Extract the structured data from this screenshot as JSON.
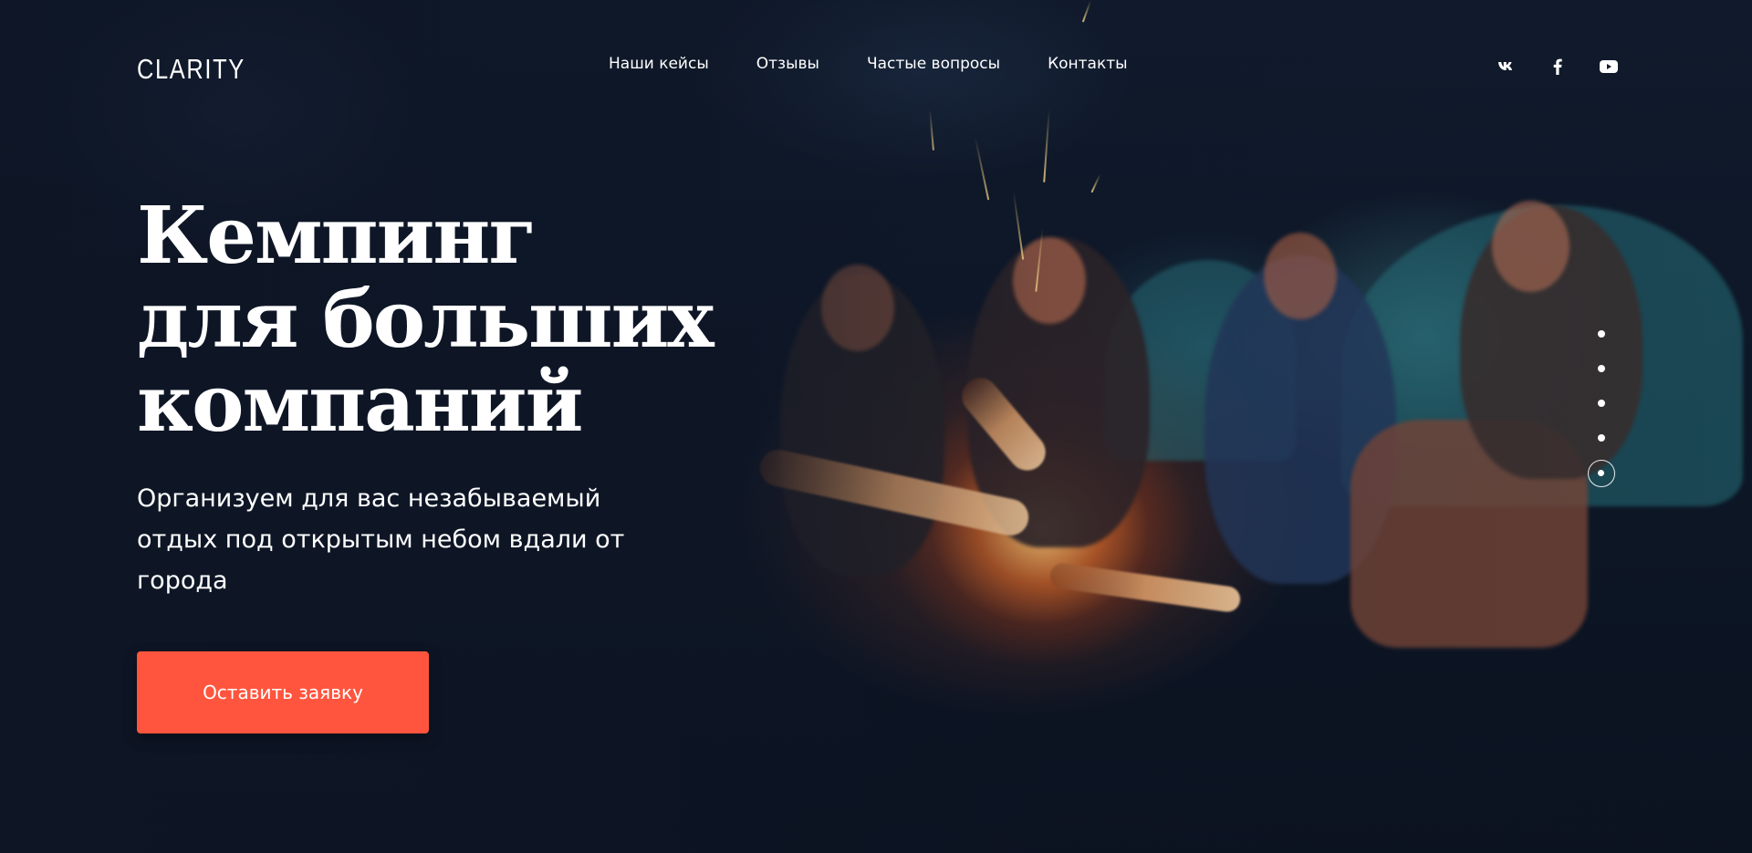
{
  "brand": {
    "logo_text": "CLARITY",
    "accent_color": "#ff553e"
  },
  "nav": {
    "items": [
      {
        "label": "Наши кейсы"
      },
      {
        "label": "Отзывы"
      },
      {
        "label": "Частые вопросы"
      },
      {
        "label": "Контакты"
      }
    ]
  },
  "socials": [
    {
      "icon": "vk-icon"
    },
    {
      "icon": "facebook-icon"
    },
    {
      "icon": "youtube-icon"
    }
  ],
  "hero": {
    "title_lines": [
      "Кемпинг",
      "для больших",
      "компаний"
    ],
    "subtitle": "Организуем для вас незабываемый отдых под открытым небом вдали от города",
    "cta_label": "Оставить заявку",
    "background": "campfire-night-photo"
  },
  "slider": {
    "total": 5,
    "active_index": 5
  }
}
